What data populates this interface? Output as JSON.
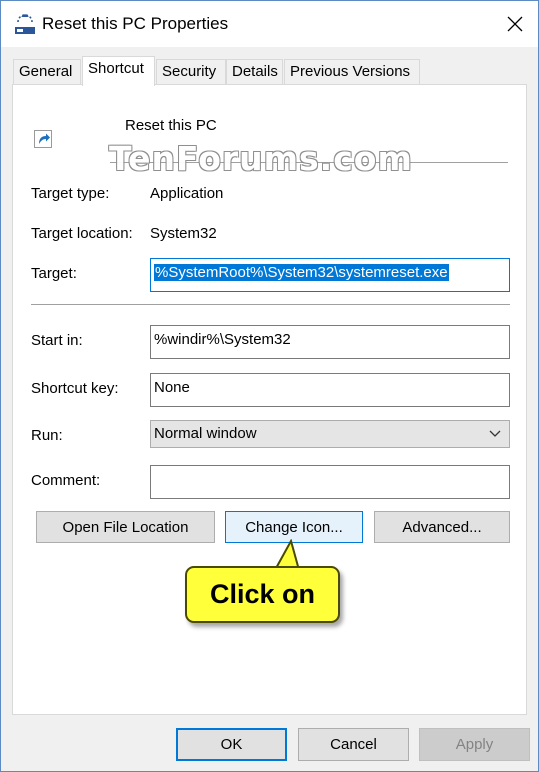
{
  "window": {
    "title": "Reset this PC Properties",
    "close_icon": "close-icon"
  },
  "tabs": [
    {
      "label": "General",
      "active": false
    },
    {
      "label": "Shortcut",
      "active": true
    },
    {
      "label": "Security",
      "active": false
    },
    {
      "label": "Details",
      "active": false
    },
    {
      "label": "Previous Versions",
      "active": false
    }
  ],
  "shortcut": {
    "name": "Reset this PC",
    "watermark": "TenForums.com",
    "target_type_label": "Target type:",
    "target_type_value": "Application",
    "target_location_label": "Target location:",
    "target_location_value": "System32",
    "target_label": "Target:",
    "target_value": "%SystemRoot%\\System32\\systemreset.exe",
    "start_in_label": "Start in:",
    "start_in_value": "%windir%\\System32",
    "shortcut_key_label": "Shortcut key:",
    "shortcut_key_value": "None",
    "run_label": "Run:",
    "run_value": "Normal window",
    "comment_label": "Comment:",
    "comment_value": ""
  },
  "buttons": {
    "open_file_location": "Open File Location",
    "change_icon": "Change Icon...",
    "advanced": "Advanced...",
    "ok": "OK",
    "cancel": "Cancel",
    "apply": "Apply"
  },
  "callout": {
    "text": "Click on",
    "color": "#ffff3a"
  },
  "colors": {
    "accent": "#0078d7"
  }
}
